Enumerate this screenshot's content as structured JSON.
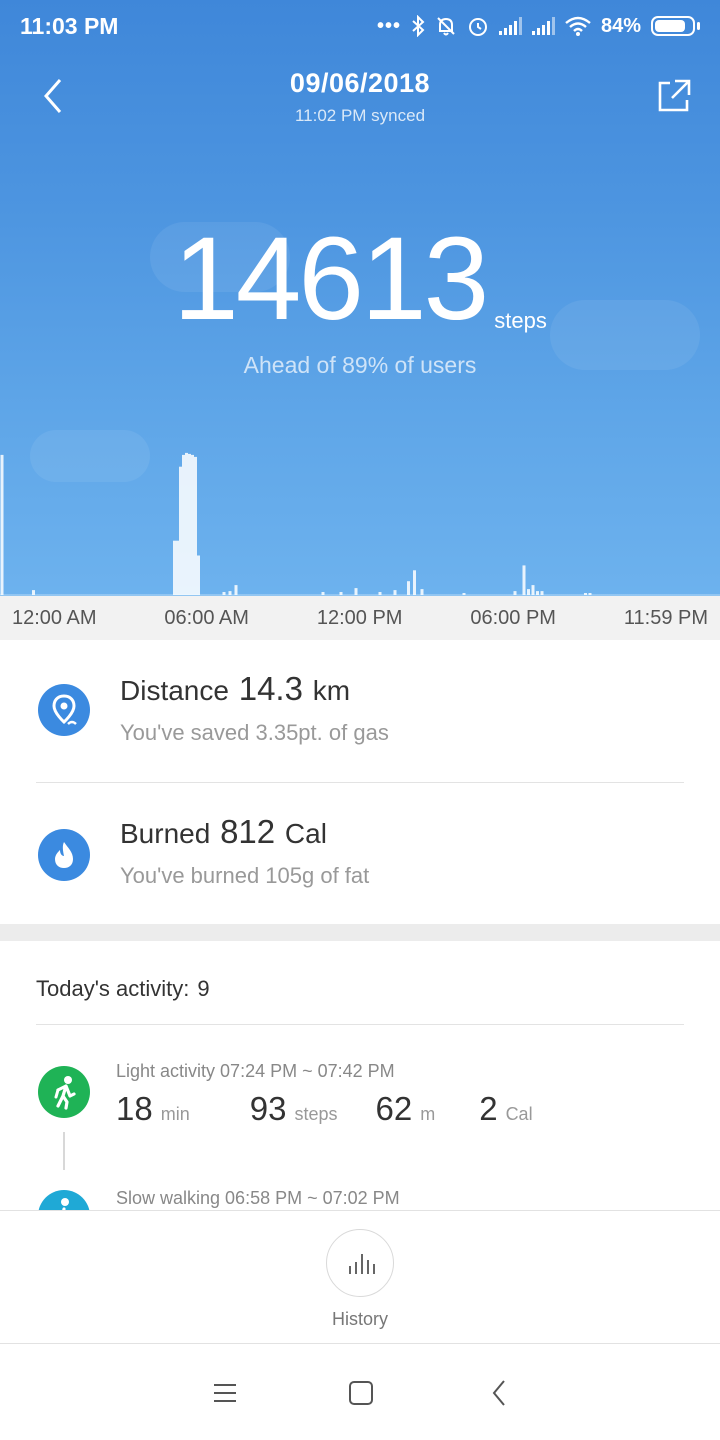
{
  "status_bar": {
    "time": "11:03 PM",
    "icons": [
      "more-dots-icon",
      "bluetooth-icon",
      "mute-bell-icon",
      "alarm-icon",
      "signal-icon",
      "signal-icon",
      "wifi-icon"
    ],
    "battery_percent": "84%",
    "battery_level": 0.84
  },
  "header": {
    "date": "09/06/2018",
    "sync_status": "11:02 PM synced",
    "back_icon": "chevron-left-icon",
    "share_icon": "share-icon"
  },
  "steps": {
    "count": "14613",
    "unit": "steps",
    "ranking": "Ahead of 89% of users"
  },
  "chart_data": {
    "type": "bar",
    "description_unit": "steps per interval",
    "x_range": [
      "12:00 AM",
      "11:59 PM"
    ],
    "tick_labels": [
      "12:00 AM",
      "06:00 AM",
      "12:00 PM",
      "06:00 PM",
      "11:59 PM"
    ],
    "bars": [
      {
        "t": 0.0,
        "v": 142
      },
      {
        "t": 1.05,
        "v": 5
      },
      {
        "t": 5.75,
        "v": 55
      },
      {
        "t": 5.85,
        "v": 55
      },
      {
        "t": 5.95,
        "v": 130
      },
      {
        "t": 6.05,
        "v": 142
      },
      {
        "t": 6.15,
        "v": 144
      },
      {
        "t": 6.25,
        "v": 143
      },
      {
        "t": 6.35,
        "v": 142
      },
      {
        "t": 6.45,
        "v": 140
      },
      {
        "t": 6.55,
        "v": 40
      },
      {
        "t": 7.4,
        "v": 3
      },
      {
        "t": 7.6,
        "v": 4
      },
      {
        "t": 7.8,
        "v": 10
      },
      {
        "t": 10.7,
        "v": 3
      },
      {
        "t": 11.3,
        "v": 3
      },
      {
        "t": 11.8,
        "v": 7
      },
      {
        "t": 12.6,
        "v": 3
      },
      {
        "t": 13.1,
        "v": 5
      },
      {
        "t": 13.55,
        "v": 14
      },
      {
        "t": 13.75,
        "v": 25
      },
      {
        "t": 14.0,
        "v": 6
      },
      {
        "t": 15.4,
        "v": 2
      },
      {
        "t": 17.1,
        "v": 4
      },
      {
        "t": 17.4,
        "v": 30
      },
      {
        "t": 17.55,
        "v": 6
      },
      {
        "t": 17.7,
        "v": 10
      },
      {
        "t": 17.85,
        "v": 4
      },
      {
        "t": 18.0,
        "v": 4
      },
      {
        "t": 19.45,
        "v": 2
      },
      {
        "t": 19.6,
        "v": 2
      }
    ]
  },
  "distance": {
    "label": "Distance",
    "value": "14.3",
    "unit": "km",
    "note": "You've saved 3.35pt. of gas",
    "icon": "location-pin-icon"
  },
  "calories": {
    "label": "Burned",
    "value": "812",
    "unit": "Cal",
    "note": "You've burned 105g of fat",
    "icon": "flame-icon"
  },
  "activity": {
    "heading": "Today's activity:",
    "count": "9",
    "items": [
      {
        "title": "Light activity 07:24 PM ~ 07:42 PM",
        "icon": "walking-person-icon",
        "color": "#1fb356",
        "duration": "18",
        "duration_unit": "min",
        "steps": "93",
        "steps_unit": "steps",
        "distance": "62",
        "distance_unit": "m",
        "cal": "2",
        "cal_unit": "Cal"
      },
      {
        "title": "Slow walking 06:58 PM ~ 07:02 PM",
        "icon": "walking-person-icon",
        "color": "#1fa9d6"
      }
    ]
  },
  "history": {
    "label": "History",
    "icon": "bar-chart-icon"
  },
  "system_nav": {
    "menu_icon": "menu-icon",
    "home_icon": "home-square-icon",
    "back_icon": "back-triangle-icon"
  }
}
